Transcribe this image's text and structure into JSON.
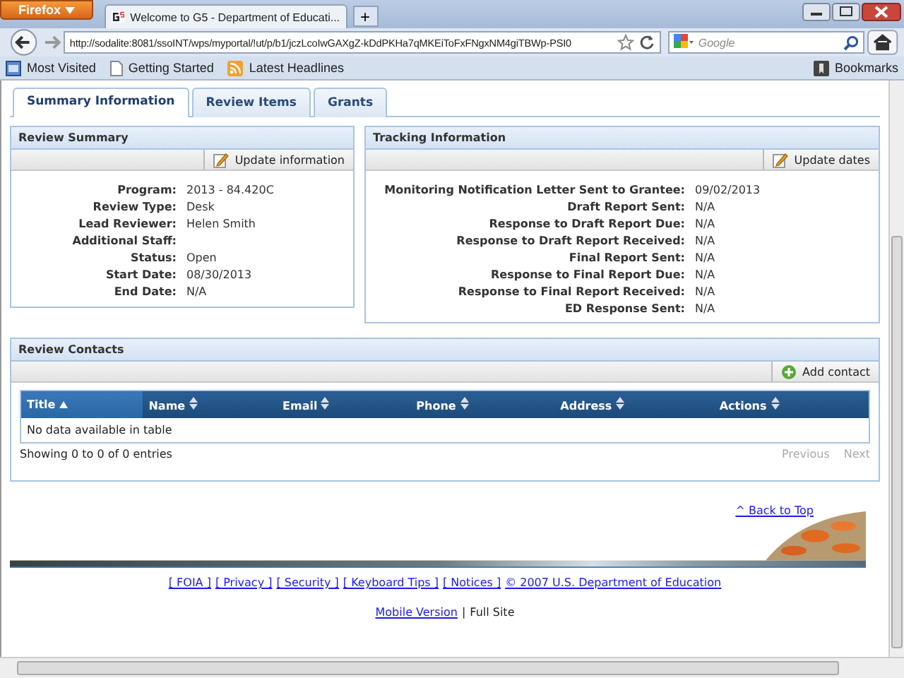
{
  "browser": {
    "menu_button": "Firefox",
    "tab_title": "Welcome to G5 - Department of Educati...",
    "new_tab": "+",
    "url": "http://sodalite:8081/ssoINT/wps/myportal/!ut/p/b1/jczLcoIwGAXgZ-kDdPKHa7qMKEiToFxFNgxNM4giTBWp-PSI0",
    "search_placeholder": "Google",
    "bookmarks": [
      {
        "label": "Most Visited",
        "kind": "folder"
      },
      {
        "label": "Getting Started",
        "kind": "page"
      },
      {
        "label": "Latest Headlines",
        "kind": "feed"
      }
    ],
    "bookmarks_menu": "Bookmarks"
  },
  "tabs": [
    {
      "label": "Summary Information",
      "selected": true
    },
    {
      "label": "Review Items",
      "selected": false
    },
    {
      "label": "Grants",
      "selected": false
    }
  ],
  "review_summary": {
    "title": "Review Summary",
    "action": "Update information",
    "fields": [
      {
        "label": "Program:",
        "value": "2013 - 84.420C"
      },
      {
        "label": "Review Type:",
        "value": "Desk"
      },
      {
        "label": "Lead Reviewer:",
        "value": "Helen Smith"
      },
      {
        "label": "Additional Staff:"
      },
      {
        "label": "Status:",
        "value": "Open"
      },
      {
        "label": "Start Date:",
        "value": "08/30/2013"
      },
      {
        "label": "End Date:",
        "value": "N/A"
      }
    ]
  },
  "tracking_information": {
    "title": "Tracking Information",
    "action": "Update dates",
    "fields": [
      {
        "label": "Monitoring Notification Letter Sent to Grantee:",
        "value": "09/02/2013"
      },
      {
        "label": "Draft Report Sent:",
        "value": "N/A"
      },
      {
        "label": "Response to Draft Report Due:",
        "value": "N/A"
      },
      {
        "label": "Response to Draft Report Received:",
        "value": "N/A"
      },
      {
        "label": "Final Report Sent:",
        "value": "N/A"
      },
      {
        "label": "Response to Final Report Due:",
        "value": "N/A"
      },
      {
        "label": "Response to Final Report Received:",
        "value": "N/A"
      },
      {
        "label": "ED Response Sent:",
        "value": "N/A"
      }
    ]
  },
  "review_contacts": {
    "title": "Review Contacts",
    "action": "Add contact",
    "columns": [
      {
        "label": "Title",
        "sorted": true
      },
      {
        "label": "Name",
        "sorted": false
      },
      {
        "label": "Email",
        "sorted": false
      },
      {
        "label": "Phone",
        "sorted": false
      },
      {
        "label": "Address",
        "sorted": false
      },
      {
        "label": "Actions",
        "sorted": false
      }
    ],
    "empty_text": "No data available in table",
    "info": "Showing 0 to 0 of 0 entries",
    "pagination": [
      {
        "label": "Previous",
        "disabled": true
      },
      {
        "label": "Next",
        "disabled": true
      }
    ]
  },
  "footer": {
    "back_to_top": "^ Back to Top",
    "links": [
      "[ FOIA ]",
      "[ Privacy ]",
      "[ Security ]",
      "[ Keyboard Tips ]",
      "[ Notices ]",
      "© 2007 U.S. Department of Education"
    ],
    "mobile_link": "Mobile Version",
    "separator": "|",
    "current": "Full Site"
  }
}
